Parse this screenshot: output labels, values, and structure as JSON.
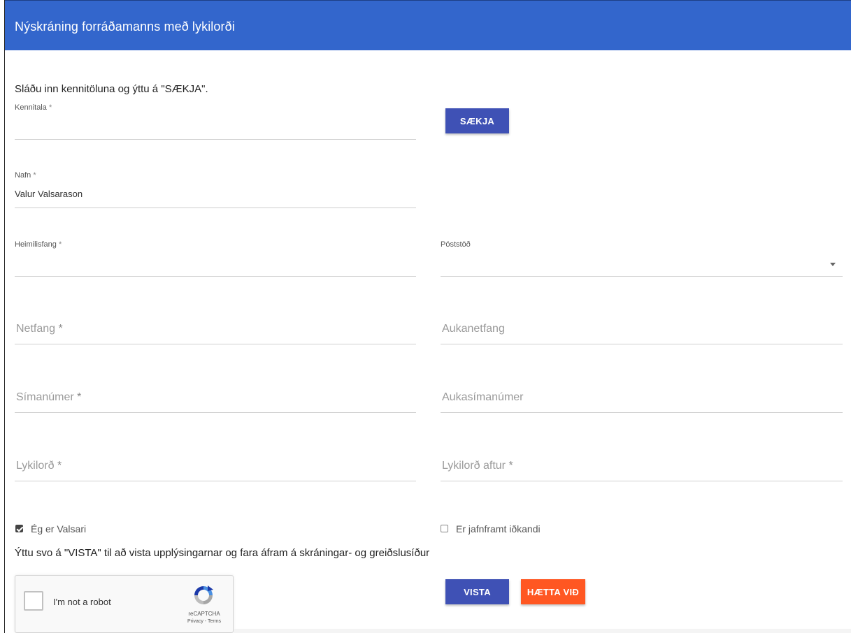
{
  "header": {
    "title": "Nýskráning forráðamanns með lykilorði"
  },
  "instructions": {
    "top": "Sláðu inn kennitöluna og ýttu á \"SÆKJA\".",
    "bottom": "Ýttu svo á \"VISTA\" til að vista upplýsingarnar og fara áfram á skráningar- og greiðslusíður"
  },
  "fields": {
    "kennitala": {
      "label": "Kennitala",
      "required": "*",
      "value": ""
    },
    "nafn": {
      "label": "Nafn",
      "required": "*",
      "value": "Valur Valsarason"
    },
    "heimilisfang": {
      "label": "Heimilisfang",
      "required": "*",
      "value": ""
    },
    "poststod": {
      "label": "Póststöð",
      "value": ""
    },
    "netfang": {
      "label": "Netfang",
      "required": "*"
    },
    "aukanetfang": {
      "label": "Aukanetfang"
    },
    "simanumer": {
      "label": "Símanúmer",
      "required": "*"
    },
    "aukasimanumer": {
      "label": "Aukasímanúmer"
    },
    "lykilord": {
      "label": "Lykilorð",
      "required": "*"
    },
    "lykilord_aftur": {
      "label": "Lykilorð aftur",
      "required": "*"
    }
  },
  "buttons": {
    "saekja": "SÆKJA",
    "vista": "VISTA",
    "haetta": "HÆTTA VIÐ"
  },
  "checkboxes": {
    "valsari": {
      "label": "Ég er Valsari",
      "checked": true
    },
    "idkandi": {
      "label": "Er jafnframt iðkandi",
      "checked": false
    }
  },
  "recaptcha": {
    "text": "I'm not a robot",
    "brand": "reCAPTCHA",
    "links": "Privacy - Terms"
  },
  "colors": {
    "header": "#3366cc",
    "primary_button": "#3f51b5",
    "cancel_button": "#ff5722"
  },
  "icons": {
    "dropdown": "caret-down-icon",
    "recaptcha": "recaptcha-logo-icon"
  }
}
